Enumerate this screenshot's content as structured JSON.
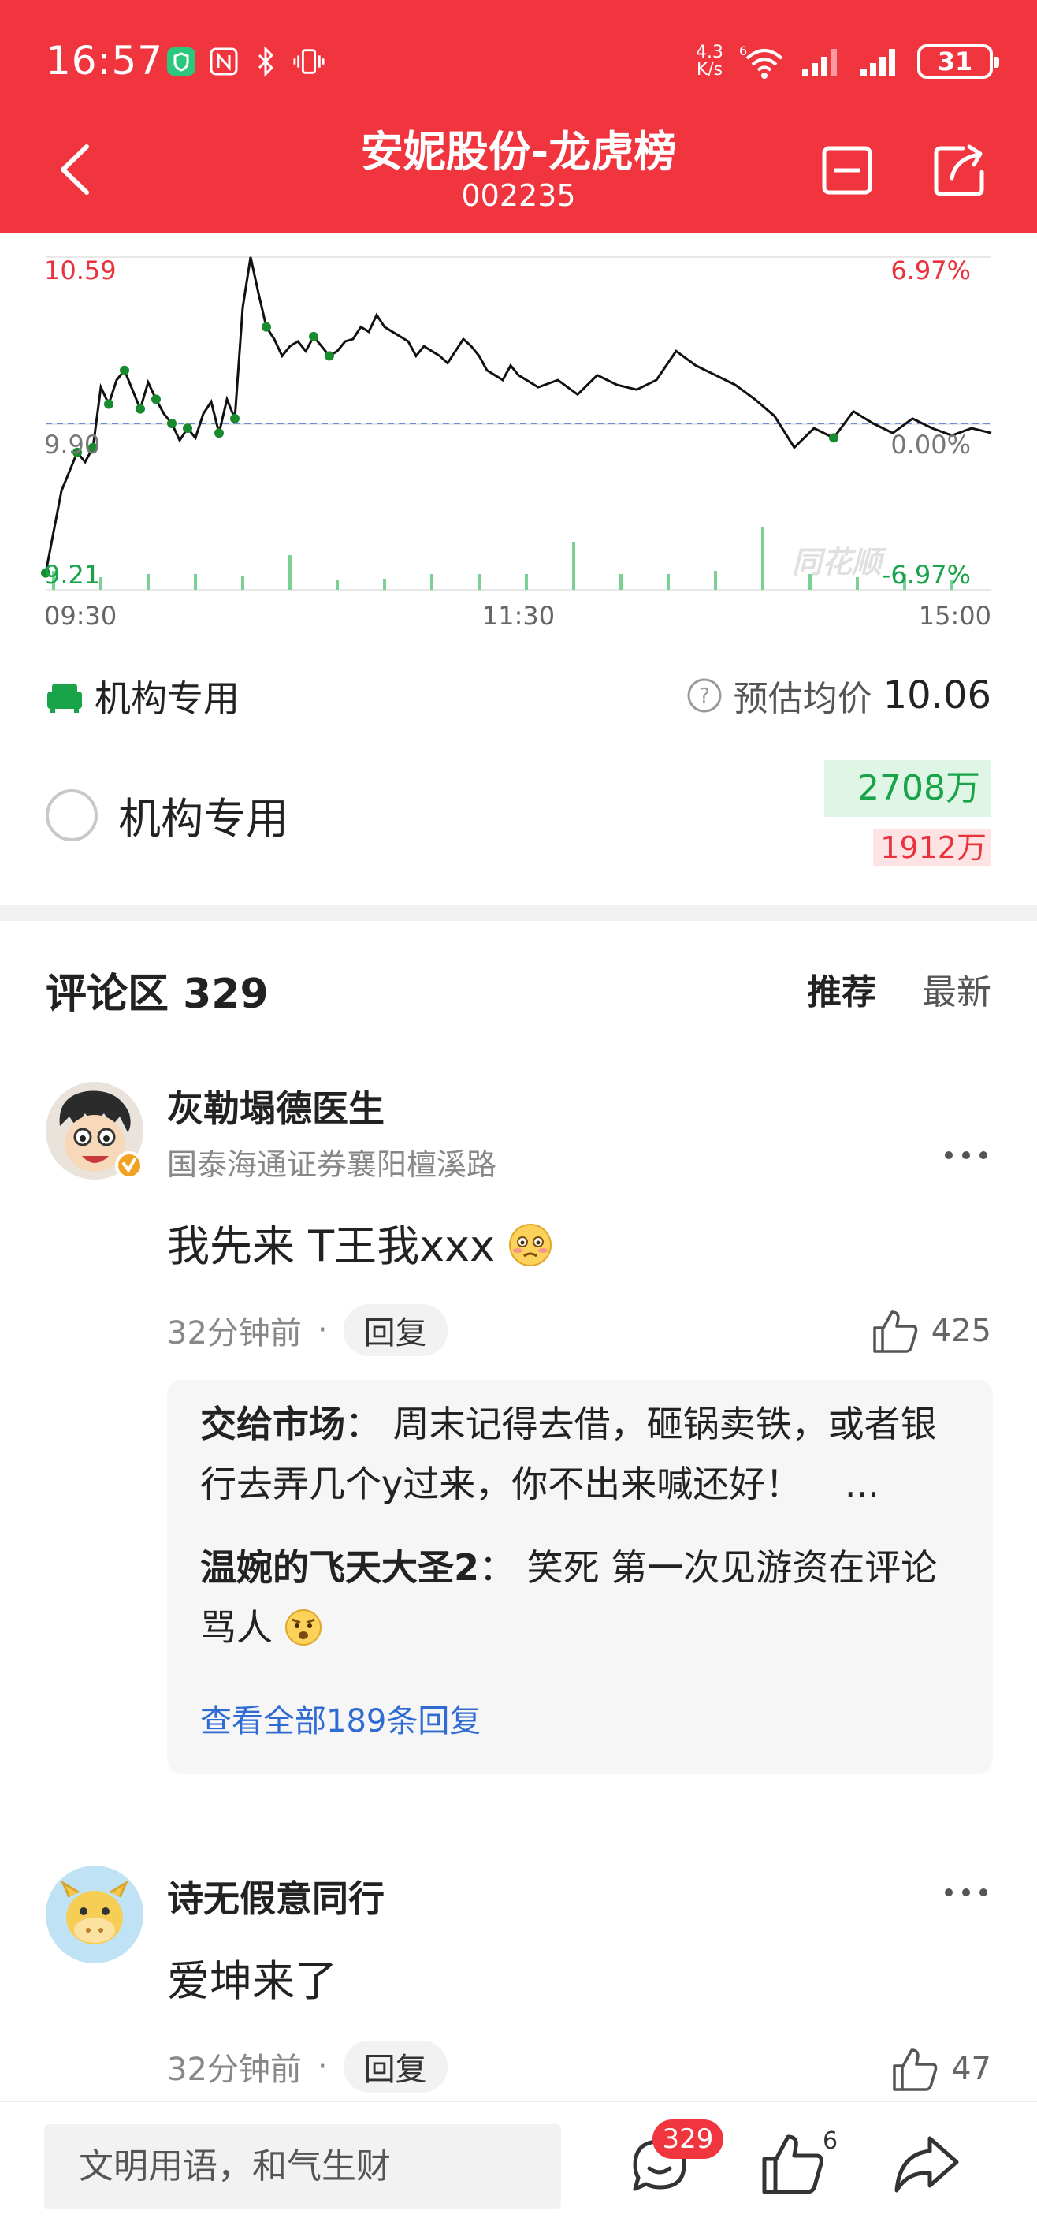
{
  "status_bar": {
    "time": "16:57",
    "net_speed_value": "4.3",
    "net_speed_unit": "K/s",
    "battery": "31"
  },
  "header": {
    "title": "安妮股份-龙虎榜",
    "code": "002235"
  },
  "chart_data": {
    "type": "line",
    "title": "",
    "x_ticks": [
      "09:30",
      "11:30",
      "15:00"
    ],
    "y_left_ticks": [
      "10.59",
      "9.90",
      "9.21"
    ],
    "y_right_ticks": [
      "6.97%",
      "0.00%",
      "-6.97%"
    ],
    "watermark": "同花顺",
    "prev_close": 9.9,
    "ylim": [
      9.21,
      10.59
    ],
    "series": [
      {
        "x": [
          0,
          2,
          4,
          6,
          8,
          10,
          12,
          14,
          16,
          18,
          20,
          22,
          24,
          26,
          28,
          30,
          32,
          34,
          36,
          38,
          40,
          42,
          44,
          46,
          48,
          50,
          52,
          54,
          56,
          58,
          60,
          62,
          64,
          66,
          68,
          70,
          72,
          74,
          76,
          78,
          80,
          82,
          84,
          86,
          88,
          90,
          92,
          94,
          96,
          98,
          100,
          102,
          104,
          106,
          108,
          110,
          112,
          114,
          116,
          118,
          120,
          125,
          130,
          135,
          140,
          145,
          150,
          155,
          160,
          165,
          170,
          175,
          180,
          185,
          190,
          195,
          200,
          205,
          210,
          215,
          220,
          225,
          230,
          235,
          240
        ],
        "y": [
          9.28,
          9.45,
          9.62,
          9.7,
          9.78,
          9.74,
          9.8,
          10.05,
          9.98,
          10.08,
          10.12,
          10.04,
          9.96,
          10.07,
          10.0,
          9.94,
          9.9,
          9.83,
          9.88,
          9.84,
          9.94,
          9.99,
          9.86,
          10.0,
          9.92,
          10.38,
          10.59,
          10.44,
          10.3,
          10.25,
          10.18,
          10.22,
          10.24,
          10.2,
          10.26,
          10.22,
          10.18,
          10.2,
          10.24,
          10.25,
          10.3,
          10.28,
          10.35,
          10.3,
          10.28,
          10.26,
          10.24,
          10.18,
          10.22,
          10.2,
          10.18,
          10.15,
          10.2,
          10.25,
          10.22,
          10.18,
          10.12,
          10.1,
          10.08,
          10.14,
          10.1,
          10.05,
          10.08,
          10.02,
          10.1,
          10.06,
          10.04,
          10.08,
          10.2,
          10.14,
          10.1,
          10.06,
          10.0,
          9.93,
          9.8,
          9.88,
          9.84,
          9.95,
          9.9,
          9.86,
          9.92,
          9.88,
          9.85,
          9.88,
          9.86
        ]
      }
    ],
    "volume": [
      0.12,
      0.08,
      0.1,
      0.1,
      0.09,
      0.22,
      0.06,
      0.07,
      0.1,
      0.1,
      0.1,
      0.3,
      0.1,
      0.1,
      0.12,
      0.4,
      0.1,
      0.08,
      0.1,
      0.06
    ]
  },
  "institution": {
    "label_row1": "机构专用",
    "avg_price_label": "预估均价",
    "avg_price": "10.06",
    "label_row2": "机构专用",
    "buy_amount": "2708万",
    "sell_amount": "1912万"
  },
  "comments": {
    "title": "评论区 329",
    "tabs": [
      "推荐",
      "最新"
    ],
    "items": [
      {
        "user": "灰勒塌德医生",
        "broker": "国泰海通证券襄阳檀溪路",
        "text": "我先来 T王我xxx",
        "time": "32分钟前",
        "reply_label": "回复",
        "likes": "425",
        "replies": [
          {
            "user": "交给市场",
            "sep": "：",
            "text": "周末记得去借，砸锅卖铁，或者银行去弄几个y过来，你不出来喊还好！",
            "ellipsis": "..."
          },
          {
            "user": "温婉的飞天大圣2",
            "sep": "：",
            "text": "笑死 第一次见游资在评论骂人"
          }
        ],
        "view_all": "查看全部189条回复"
      },
      {
        "user": "诗无假意同行",
        "text": "爱坤来了",
        "time": "32分钟前",
        "reply_label": "回复",
        "likes": "47"
      }
    ]
  },
  "bottom_bar": {
    "placeholder": "文明用语，和气生财",
    "comment_count": "329",
    "like_count": "6"
  },
  "colors": {
    "brand_red": "#f0353f",
    "rise": "#e8323c",
    "fall": "#1aa44a",
    "link": "#2f6bd3"
  }
}
